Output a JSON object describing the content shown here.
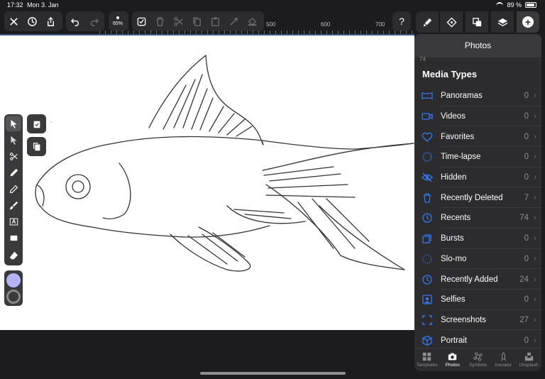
{
  "status": {
    "time": "17:32",
    "date": "Mon 3. Jan",
    "battery": "89 %"
  },
  "toolbar": {
    "zoom": "65%",
    "ruler_labels": [
      "500",
      "600",
      "700"
    ]
  },
  "panel": {
    "title": "Photos",
    "sub_count": "74",
    "section_title": "Media Types",
    "rows": [
      {
        "label": "Panoramas",
        "count": "0",
        "icon": "panorama-icon"
      },
      {
        "label": "Videos",
        "count": "0",
        "icon": "video-icon"
      },
      {
        "label": "Favorites",
        "count": "0",
        "icon": "heart-icon"
      },
      {
        "label": "Time-lapse",
        "count": "0",
        "icon": "timelapse-icon"
      },
      {
        "label": "Hidden",
        "count": "0",
        "icon": "eye-slash-icon"
      },
      {
        "label": "Recently Deleted",
        "count": "7",
        "icon": "trash-icon"
      },
      {
        "label": "Recents",
        "count": "74",
        "icon": "clock-icon"
      },
      {
        "label": "Bursts",
        "count": "0",
        "icon": "bursts-icon"
      },
      {
        "label": "Slo-mo",
        "count": "0",
        "icon": "slomo-icon"
      },
      {
        "label": "Recently Added",
        "count": "24",
        "icon": "clock-icon"
      },
      {
        "label": "Selfies",
        "count": "0",
        "icon": "selfie-icon"
      },
      {
        "label": "Screenshots",
        "count": "27",
        "icon": "screenshot-icon"
      },
      {
        "label": "Portrait",
        "count": "0",
        "icon": "cube-icon"
      }
    ],
    "tabs": [
      {
        "label": "Templates",
        "icon": "grid-icon"
      },
      {
        "label": "Photos",
        "icon": "camera-icon"
      },
      {
        "label": "Symbols",
        "icon": "command-icon"
      },
      {
        "label": "Iconator",
        "icon": "rocket-icon"
      },
      {
        "label": "Unsplash",
        "icon": "unsplash-icon"
      }
    ]
  },
  "colors": {
    "accent": "#3478f6",
    "panel_bg": "#2c2c2e",
    "swatch": "#b3b3f5"
  }
}
